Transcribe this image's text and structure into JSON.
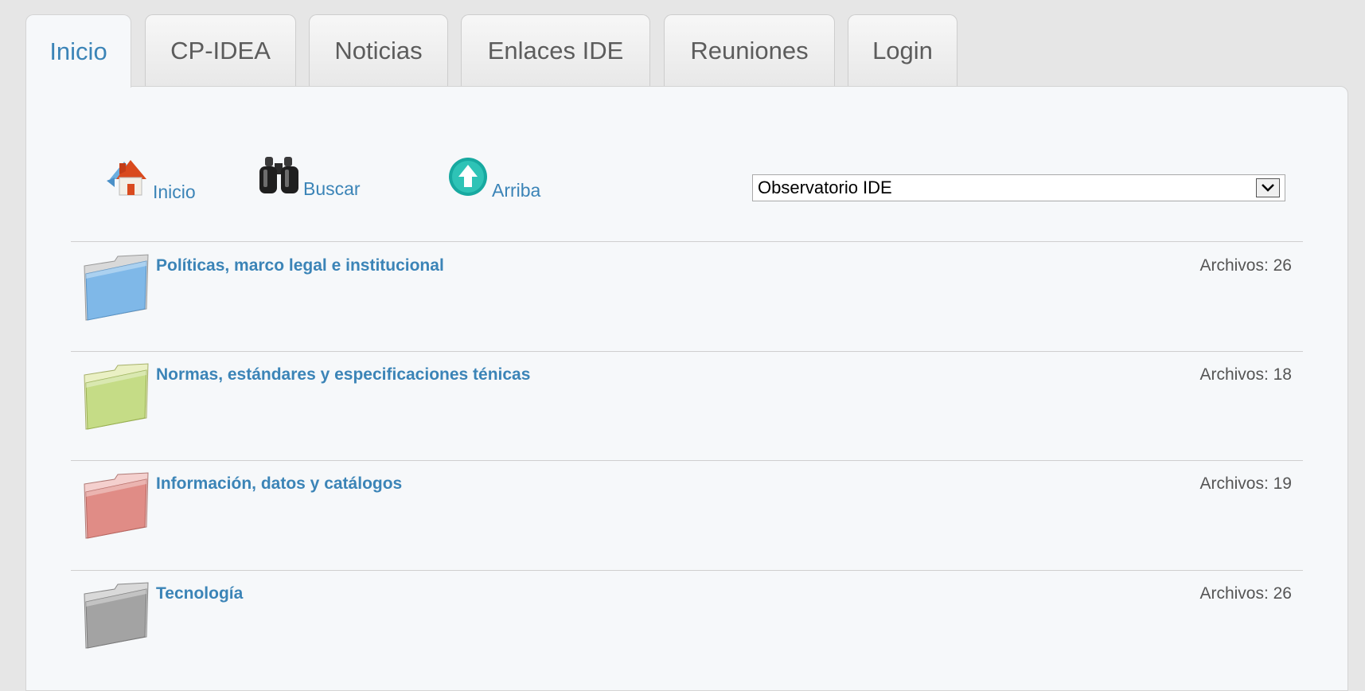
{
  "tabs": [
    {
      "label": "Inicio",
      "active": true
    },
    {
      "label": "CP-IDEA"
    },
    {
      "label": "Noticias"
    },
    {
      "label": "Enlaces IDE"
    },
    {
      "label": "Reuniones"
    },
    {
      "label": "Login"
    }
  ],
  "toolbar": {
    "home_label": "Inicio",
    "search_label": "Buscar",
    "up_label": "Arriba",
    "selector_value": "Observatorio IDE"
  },
  "folders": [
    {
      "title": "Políticas, marco legal e institucional",
      "count": "Archivos: 26",
      "color": "#7fb8e8"
    },
    {
      "title": "Normas, estándares y especificaciones ténicas",
      "count": "Archivos: 18",
      "color": "#c5dc86"
    },
    {
      "title": "Información, datos y catálogos",
      "count": "Archivos: 19",
      "color": "#e08c86"
    },
    {
      "title": "Tecnología",
      "count": "Archivos: 26",
      "color": "#a3a3a3"
    }
  ],
  "colors": {
    "link": "#3b84b7",
    "panel": "#f6f8fa"
  }
}
